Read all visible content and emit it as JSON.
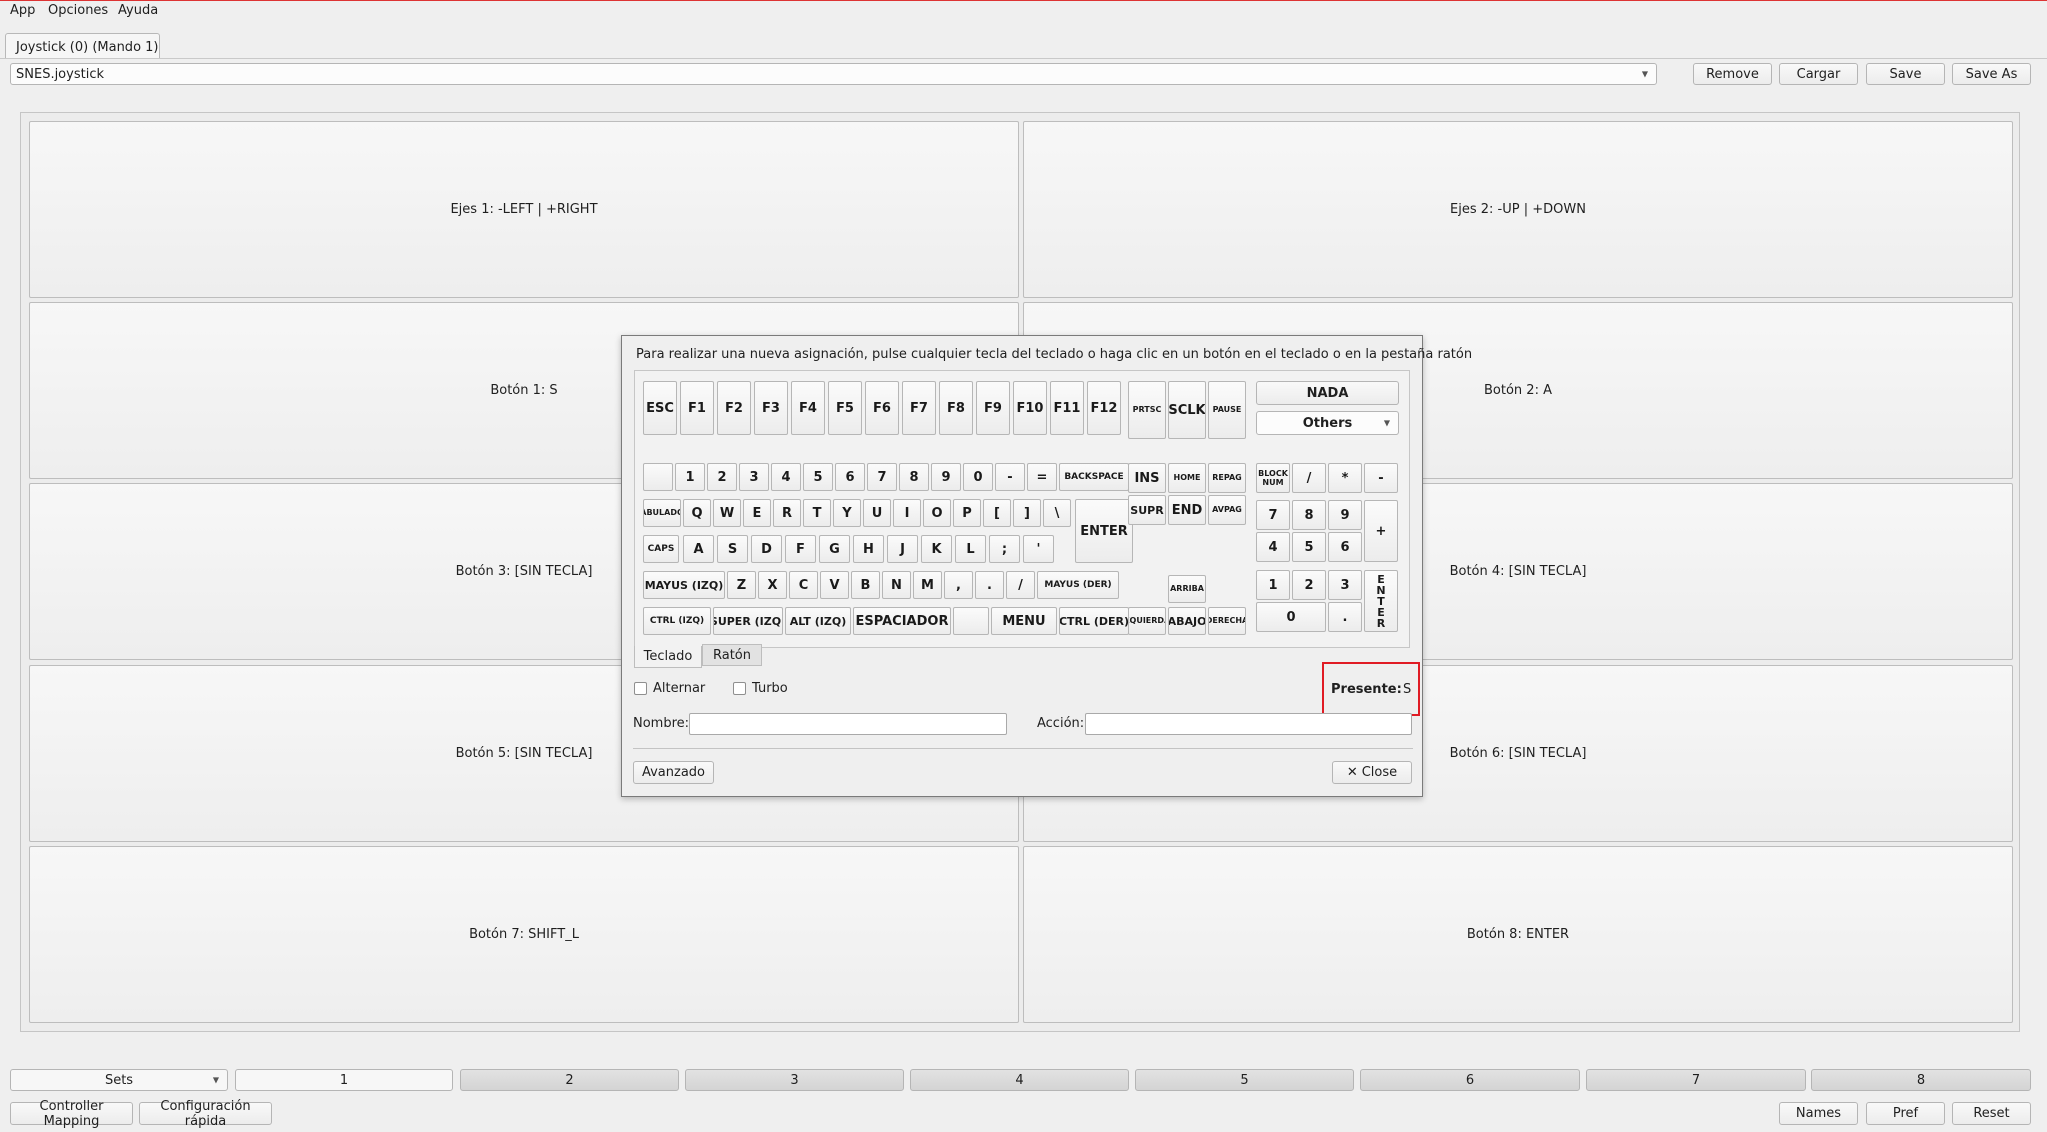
{
  "menu": [
    "App",
    "Opciones",
    "Ayuda"
  ],
  "tab_label": "Joystick (0) (Mando 1)",
  "profile": {
    "selected": "SNES.joystick",
    "buttons": [
      "Remove",
      "Cargar",
      "Save",
      "Save As"
    ]
  },
  "cells": [
    "Ejes 1: -LEFT | +RIGHT",
    "Ejes 2: -UP | +DOWN",
    "Botón 1: S",
    "Botón 2: A",
    "Botón 3: [SIN TECLA]",
    "Botón 4: [SIN TECLA]",
    "Botón 5: [SIN TECLA]",
    "Botón 6: [SIN TECLA]",
    "Botón 7: SHIFT_L",
    "Botón 8: ENTER"
  ],
  "dialog": {
    "message": "Para realizar una nueva asignación, pulse cualquier tecla del teclado o haga clic en un botón en el teclado o en la pestaña ratón",
    "keys": {
      "fn": [
        "ESC",
        "F1",
        "F2",
        "F3",
        "F4",
        "F5",
        "F6",
        "F7",
        "F8",
        "F9",
        "F10",
        "F11",
        "F12"
      ],
      "sys": [
        "PRTSC",
        "SCLK",
        "PAUSE"
      ],
      "nada": "NADA",
      "others": "Others",
      "num_row": [
        "",
        "1",
        "2",
        "3",
        "4",
        "5",
        "6",
        "7",
        "8",
        "9",
        "0",
        "-",
        "=",
        "BACKSPACE"
      ],
      "q_row": [
        "ABULADO",
        "Q",
        "W",
        "E",
        "R",
        "T",
        "Y",
        "U",
        "I",
        "O",
        "P",
        "[",
        "]",
        "\\"
      ],
      "a_row": [
        "CAPS",
        "A",
        "S",
        "D",
        "F",
        "G",
        "H",
        "J",
        "K",
        "L",
        ";",
        "'"
      ],
      "enter": "ENTER",
      "z_row": [
        "MAYUS (IZQ)",
        "Z",
        "X",
        "C",
        "V",
        "B",
        "N",
        "M",
        ",",
        ".",
        "/",
        "MAYUS (DER)"
      ],
      "bottom_row": [
        "CTRL (IZQ)",
        "SUPER (IZQ)",
        "ALT (IZQ)",
        "ESPACIADOR",
        "",
        "MENU",
        "CTRL (DER)"
      ],
      "nav_top": [
        "INS",
        "HOME",
        "REPAG"
      ],
      "nav_bottom": [
        "SUPR",
        "END",
        "AVPAG"
      ],
      "arrows": [
        "ARRIBA",
        "ZQUIERDA",
        "ABAJO",
        "DERECHA"
      ],
      "numpad_top": [
        "BLOCK NUM",
        "/",
        "*",
        "-"
      ],
      "numpad": [
        "7",
        "8",
        "9",
        "4",
        "5",
        "6",
        "1",
        "2",
        "3",
        "0",
        "."
      ],
      "numpad_plus": "+",
      "numpad_enter": [
        "E",
        "N",
        "T",
        "E",
        "R"
      ]
    },
    "subtabs": [
      "Teclado",
      "Ratón"
    ],
    "checkboxes": [
      "Alternar",
      "Turbo"
    ],
    "present_label": "Presente:",
    "present_value": "S",
    "name_label": "Nombre:",
    "name_value": "",
    "action_label": "Acción:",
    "action_value": "",
    "advanced": "Avanzado",
    "close": "Close"
  },
  "sets": {
    "label": "Sets",
    "items": [
      "1",
      "2",
      "3",
      "4",
      "5",
      "6",
      "7",
      "8"
    ]
  },
  "footer": {
    "left": [
      "Controller Mapping",
      "Configuración rápida"
    ],
    "right": [
      "Names",
      "Pref",
      "Reset"
    ]
  },
  "colors": {
    "highlight": "#e01b24",
    "accent_line": "#dd3333"
  }
}
